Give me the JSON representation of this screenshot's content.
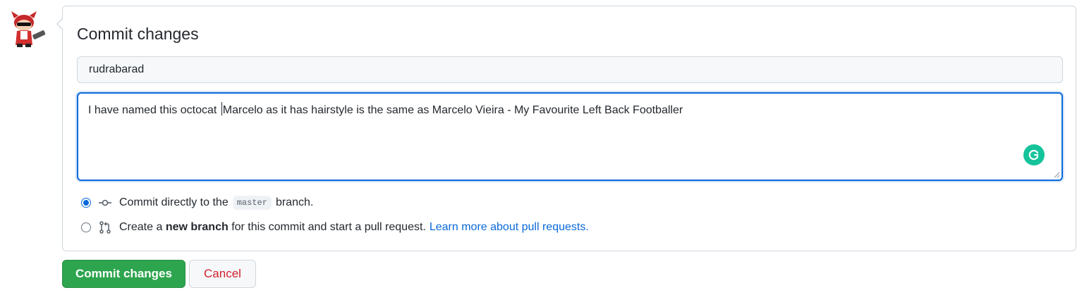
{
  "form": {
    "title": "Commit changes",
    "summary_value": "rudrabarad",
    "description_before_caret": "I have named this octocat ",
    "description_after_caret": "Marcelo as it has hairstyle is the same as Marcelo Vieira - My Favourite Left Back Footballer"
  },
  "options": {
    "direct": {
      "checked": true,
      "text_before": "Commit directly to the",
      "branch": "master",
      "text_after": "branch."
    },
    "new_branch": {
      "checked": false,
      "text_before": "Create a",
      "bold": "new branch",
      "text_after": "for this commit and start a pull request.",
      "link": "Learn more about pull requests."
    }
  },
  "buttons": {
    "commit_label": "Commit changes",
    "cancel_label": "Cancel"
  },
  "colors": {
    "commit_button": "#2da44e",
    "cancel_text": "#cf222e",
    "link": "#0969da",
    "focus_border": "#0969da"
  },
  "icons": [
    "avatar-octocat",
    "git-commit-icon",
    "git-pull-request-icon",
    "grammarly-icon"
  ]
}
